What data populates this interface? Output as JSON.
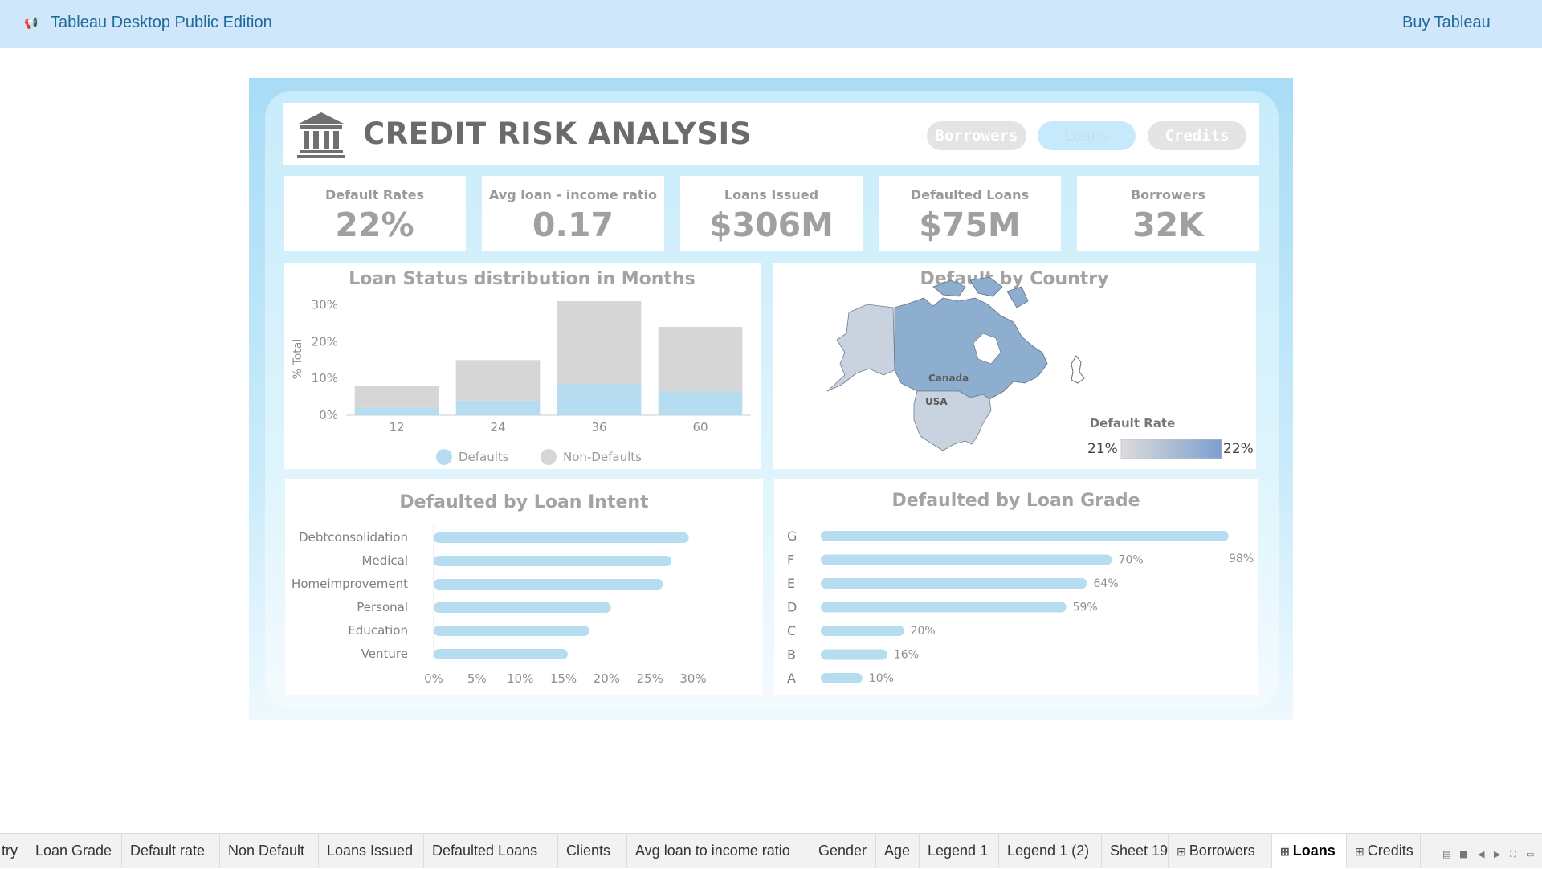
{
  "app": {
    "title": "Tableau Desktop Public Edition",
    "buy_label": "Buy Tableau",
    "logo_icon": "megaphone-icon"
  },
  "dashboard": {
    "title": "CREDIT RISK ANALYSIS",
    "nav": [
      {
        "label": "Borrowers",
        "active": false
      },
      {
        "label": "Loans",
        "active": true
      },
      {
        "label": "Credits",
        "active": false
      }
    ],
    "kpis": [
      {
        "label": "Default Rates",
        "value": "22%"
      },
      {
        "label": "Avg loan - income ratio",
        "value": "0.17"
      },
      {
        "label": "Loans Issued",
        "value": "$306M"
      },
      {
        "label": "Defaulted Loans",
        "value": "$75M"
      },
      {
        "label": "Borrowers",
        "value": "32K"
      }
    ],
    "colors": {
      "defaults": "#b6dcf0",
      "non_defaults": "#d6d6d6",
      "map_high": "#8eaed0",
      "map_low": "#c8d3df"
    },
    "map": {
      "title": "Default by Country",
      "labels": [
        "Canada",
        "USA"
      ],
      "legend_title": "Default Rate",
      "legend_min": "21%",
      "legend_max": "22%"
    }
  },
  "chart_data": [
    {
      "type": "bar",
      "title": "Loan Status distribution in Months",
      "ylabel": "% Total",
      "categories": [
        "12",
        "24",
        "36",
        "60"
      ],
      "y_ticks": [
        "30%",
        "20%",
        "10%",
        "0%"
      ],
      "ylim": [
        0,
        31
      ],
      "stacked": true,
      "series": [
        {
          "name": "Defaults",
          "values": [
            2,
            4,
            8.5,
            6.5
          ]
        },
        {
          "name": "Non-Defaults",
          "values": [
            6,
            11,
            22.5,
            17.5
          ]
        }
      ],
      "legend": "bottom"
    },
    {
      "type": "bar",
      "orientation": "horizontal",
      "title": "Defaulted by Loan Intent",
      "categories": [
        "Debtconsolidation",
        "Medical",
        "Homeimprovement",
        "Personal",
        "Education",
        "Venture"
      ],
      "values": [
        29.5,
        27.5,
        26.5,
        20.5,
        18,
        15.5
      ],
      "x_ticks": [
        "0%",
        "5%",
        "10%",
        "15%",
        "20%",
        "25%",
        "30%"
      ],
      "xlim": [
        0,
        30
      ]
    },
    {
      "type": "bar",
      "orientation": "horizontal",
      "title": "Defaulted by Loan Grade",
      "categories": [
        "G",
        "F",
        "E",
        "D",
        "C",
        "B",
        "A"
      ],
      "values": [
        98,
        70,
        64,
        59,
        20,
        16,
        10
      ],
      "value_labels": [
        "98%",
        "70%",
        "64%",
        "59%",
        "20%",
        "16%",
        "10%"
      ],
      "xlim": [
        0,
        100
      ]
    }
  ],
  "tabs": [
    {
      "label": "try",
      "icon": ""
    },
    {
      "label": "Loan Grade",
      "icon": ""
    },
    {
      "label": "Default rate",
      "icon": ""
    },
    {
      "label": "Non Default",
      "icon": ""
    },
    {
      "label": "Loans Issued",
      "icon": ""
    },
    {
      "label": "Defaulted Loans",
      "icon": ""
    },
    {
      "label": "Clients",
      "icon": ""
    },
    {
      "label": "Avg loan to income ratio",
      "icon": ""
    },
    {
      "label": "Gender",
      "icon": ""
    },
    {
      "label": "Age",
      "icon": ""
    },
    {
      "label": "Legend 1",
      "icon": ""
    },
    {
      "label": "Legend 1 (2)",
      "icon": ""
    },
    {
      "label": "Sheet 19",
      "icon": ""
    },
    {
      "label": "Borrowers",
      "icon": "dashboard-grid-icon"
    },
    {
      "label": "Loans",
      "icon": "dashboard-grid-icon",
      "active": true
    },
    {
      "label": "Credits",
      "icon": "dashboard-grid-icon"
    }
  ]
}
